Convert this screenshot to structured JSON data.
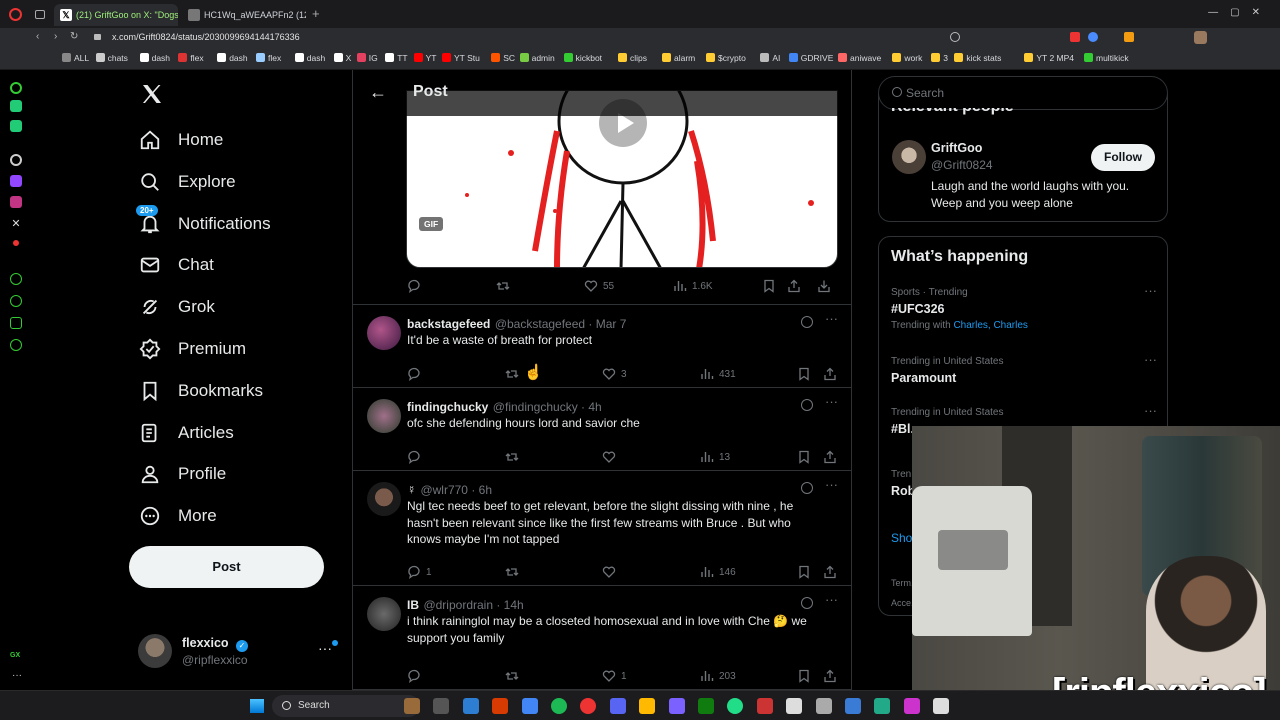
{
  "browser": {
    "tabs": [
      {
        "title": "(21) GriftGoo on X: \"Dogs...",
        "active": true
      },
      {
        "title": "HC1Wq_aWEAAPFn2 (1200...",
        "active": false
      }
    ],
    "url": "x.com/Grift0824/status/2030099694144176336",
    "bookmarks": [
      "ALL",
      "chats",
      "dash",
      "flex",
      "dash",
      "flex",
      "dash",
      "X",
      "IG",
      "TT",
      "YT",
      "YT Stu",
      "SC",
      "admin",
      "kickbot",
      "clips",
      "alarm",
      "$crypto",
      "AI",
      "GDRIVE",
      "aniwave",
      "work",
      "3",
      "kick stats",
      "YT 2 MP4",
      "multikick"
    ]
  },
  "nav": {
    "items": [
      {
        "label": "Home",
        "icon": "home-icon"
      },
      {
        "label": "Explore",
        "icon": "search-icon"
      },
      {
        "label": "Notifications",
        "icon": "bell-icon",
        "badge": "20+"
      },
      {
        "label": "Chat",
        "icon": "mail-icon"
      },
      {
        "label": "Grok",
        "icon": "grok-icon"
      },
      {
        "label": "Premium",
        "icon": "premium-icon"
      },
      {
        "label": "Bookmarks",
        "icon": "bookmark-icon"
      },
      {
        "label": "Articles",
        "icon": "articles-icon"
      },
      {
        "label": "Profile",
        "icon": "person-icon"
      },
      {
        "label": "More",
        "icon": "more-circle-icon"
      }
    ],
    "post_button": "Post",
    "account": {
      "name": "flexxico",
      "handle": "@ripflexxico"
    }
  },
  "header": {
    "title": "Post"
  },
  "media": {
    "badge": "GIF"
  },
  "main_post_actions": {
    "likes": "55",
    "views": "1.6K"
  },
  "replies": [
    {
      "name": "backstagefeed",
      "handle": "@backstagefeed",
      "time": "Mar 7",
      "text": "It'd be a waste of breath for protect",
      "replies": "",
      "likes": "3",
      "views": "431"
    },
    {
      "name": "findingchucky",
      "handle": "@findingchucky",
      "time": "4h",
      "text": "ofc she defending hours lord and savior che",
      "replies": "",
      "likes": "",
      "views": "13"
    },
    {
      "name": "☿",
      "handle": "@wlr770",
      "time": "6h",
      "text": "Ngl tec needs beef to get relevant, before the slight dissing with nine , he hasn't been relevant since like the first few streams with Bruce . But who knows maybe I'm not tapped",
      "replies": "1",
      "likes": "",
      "views": "146"
    },
    {
      "name": "IB",
      "handle": "@dripordrain",
      "time": "14h",
      "text": "i think raininglol may be a closeted homosexual and in love with Che 🤔 we support you family",
      "replies": "",
      "likes": "1",
      "views": "203"
    }
  ],
  "search": {
    "placeholder": "Search"
  },
  "relevant": {
    "title": "Relevant people",
    "name": "GriftGoo",
    "handle": "@Grift0824",
    "follow": "Follow",
    "bio": "Laugh and the world laughs with you. Weep and you weep alone"
  },
  "happening": {
    "title": "What’s happening",
    "trends": [
      {
        "category": "Sports · Trending",
        "name": "#UFC326",
        "extra_prefix": "Trending with ",
        "extra": "Charles, Charles"
      },
      {
        "category": "Trending in United States",
        "name": "Paramount"
      },
      {
        "category": "Trending in United States",
        "name": "#Bl..."
      },
      {
        "category": "Tren...",
        "name": "Rob..."
      }
    ],
    "show_more": "Sho...",
    "footer1": "Term...",
    "footer2": "Acce..."
  },
  "taskbar": {
    "search": "Search"
  },
  "overlay": {
    "watermark": "[ripflexxico]"
  },
  "colors": {
    "accent": "#1d9bf0",
    "verified": "#1d9bf0",
    "like": "#71767b"
  }
}
